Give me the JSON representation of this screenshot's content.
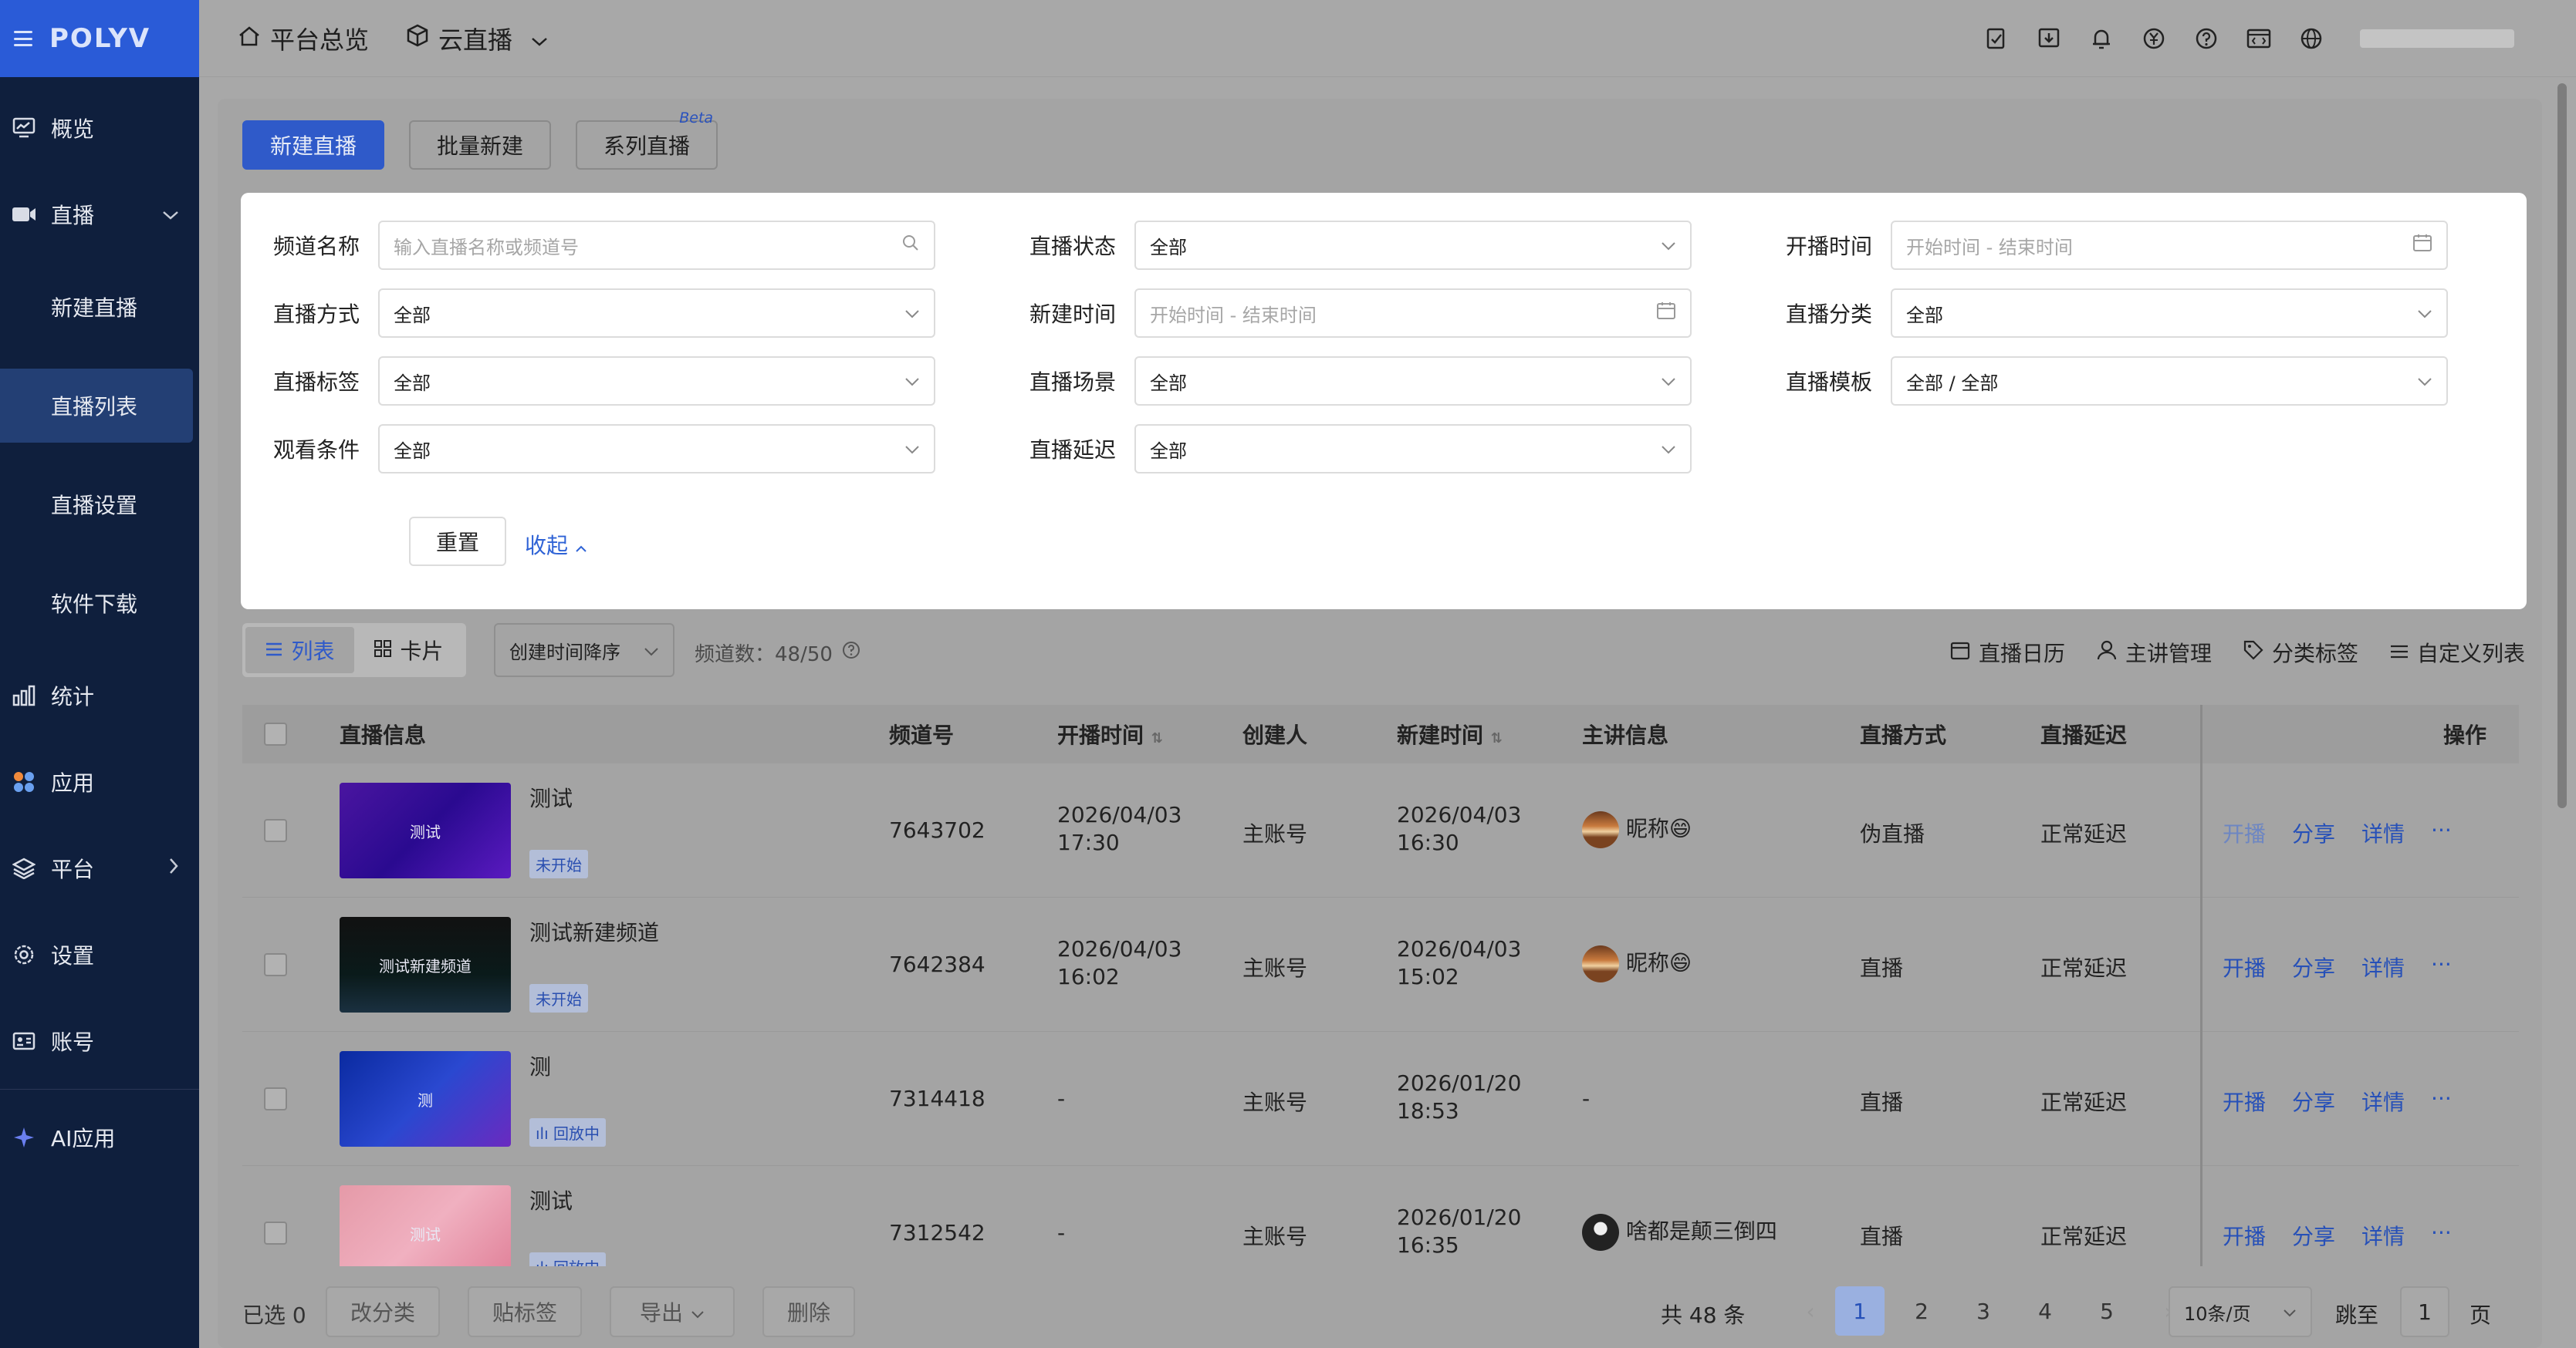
{
  "brand": {
    "logo": "POLYV"
  },
  "topbar": {
    "crumbs": [
      {
        "label": "平台总览",
        "icon": "home-icon"
      },
      {
        "label": "云直播",
        "icon": "cube-icon"
      }
    ],
    "icons": [
      "edit-doc-icon",
      "download-icon",
      "bell-icon",
      "yen-icon",
      "help-icon",
      "code-icon",
      "globe-icon"
    ]
  },
  "sidebar": {
    "items": [
      {
        "label": "概览",
        "icon": "monitor-icon"
      },
      {
        "label": "直播",
        "icon": "video-icon"
      },
      {
        "label": "统计",
        "icon": "bar-chart-icon"
      },
      {
        "label": "应用",
        "icon": "apps-icon"
      },
      {
        "label": "平台",
        "icon": "layers-icon"
      },
      {
        "label": "设置",
        "icon": "gear-icon"
      },
      {
        "label": "账号",
        "icon": "id-card-icon"
      },
      {
        "label": "AI应用",
        "icon": "sparkle-icon"
      }
    ],
    "sub_items": [
      "新建直播",
      "直播列表",
      "直播设置",
      "软件下载"
    ],
    "active_sub": "直播列表"
  },
  "actions": {
    "new_live": "新建直播",
    "batch_new": "批量新建",
    "series_live": "系列直播",
    "beta": "Beta"
  },
  "filters": {
    "channel_name": {
      "label": "频道名称",
      "placeholder": "输入直播名称或频道号"
    },
    "live_status": {
      "label": "直播状态",
      "value": "全部"
    },
    "start_time": {
      "label": "开播时间",
      "placeholder": "开始时间 - 结束时间"
    },
    "live_mode": {
      "label": "直播方式",
      "value": "全部"
    },
    "create_time": {
      "label": "新建时间",
      "placeholder": "开始时间 - 结束时间"
    },
    "live_category": {
      "label": "直播分类",
      "value": "全部"
    },
    "live_tag": {
      "label": "直播标签",
      "value": "全部"
    },
    "live_scene": {
      "label": "直播场景",
      "value": "全部"
    },
    "live_template": {
      "label": "直播模板",
      "value": "全部 / 全部"
    },
    "watch_condition": {
      "label": "观看条件",
      "value": "全部"
    },
    "live_delay": {
      "label": "直播延迟",
      "value": "全部"
    },
    "reset": "重置",
    "collapse": "收起"
  },
  "toolbar": {
    "view_list": "列表",
    "view_card": "卡片",
    "sort": "创建时间降序",
    "channel_count": "频道数：48/50",
    "calendar": "直播日历",
    "lecturer": "主讲管理",
    "category_tag": "分类标签",
    "custom_list": "自定义列表"
  },
  "table": {
    "headers": {
      "info": "直播信息",
      "channel": "频道号",
      "start": "开播时间",
      "creator": "创建人",
      "created": "新建时间",
      "lecturer": "主讲信息",
      "mode": "直播方式",
      "delay": "直播延迟",
      "ops": "操作"
    },
    "rows": [
      {
        "thumb_text": "测试",
        "title": "测试",
        "status": "未开始",
        "channel": "7643702",
        "start_date": "2026/04/03",
        "start_time": "17:30",
        "creator": "主账号",
        "created_date": "2026/04/03",
        "created_time": "16:30",
        "lecturer": "昵称😄",
        "mode": "伪直播",
        "delay": "正常延迟"
      },
      {
        "thumb_text": "测试新建频道",
        "title": "测试新建频道",
        "status": "未开始",
        "channel": "7642384",
        "start_date": "2026/04/03",
        "start_time": "16:02",
        "creator": "主账号",
        "created_date": "2026/04/03",
        "created_time": "15:02",
        "lecturer": "昵称😄",
        "mode": "直播",
        "delay": "正常延迟"
      },
      {
        "thumb_text": "测",
        "title": "测",
        "status": "回放中",
        "channel": "7314418",
        "start_date": "-",
        "start_time": "",
        "creator": "主账号",
        "created_date": "2026/01/20",
        "created_time": "18:53",
        "lecturer": "-",
        "mode": "直播",
        "delay": "正常延迟"
      },
      {
        "thumb_text": "测试",
        "title": "测试",
        "status": "回放中",
        "channel": "7312542",
        "start_date": "-",
        "start_time": "",
        "creator": "主账号",
        "created_date": "2026/01/20",
        "created_time": "16:35",
        "lecturer": "啥都是颠三倒四",
        "mode": "直播",
        "delay": "正常延迟"
      }
    ],
    "op_labels": {
      "start": "开播",
      "share": "分享",
      "detail": "详情",
      "more": "···"
    }
  },
  "bottom": {
    "selected": "已选 0",
    "recategorize": "改分类",
    "tag": "贴标签",
    "export": "导出",
    "delete": "删除",
    "total": "共 48 条",
    "pages": [
      "1",
      "2",
      "3",
      "4",
      "5"
    ],
    "page_size": "10条/页",
    "jump_to": "跳至",
    "jump_value": "1",
    "page_unit": "页"
  }
}
